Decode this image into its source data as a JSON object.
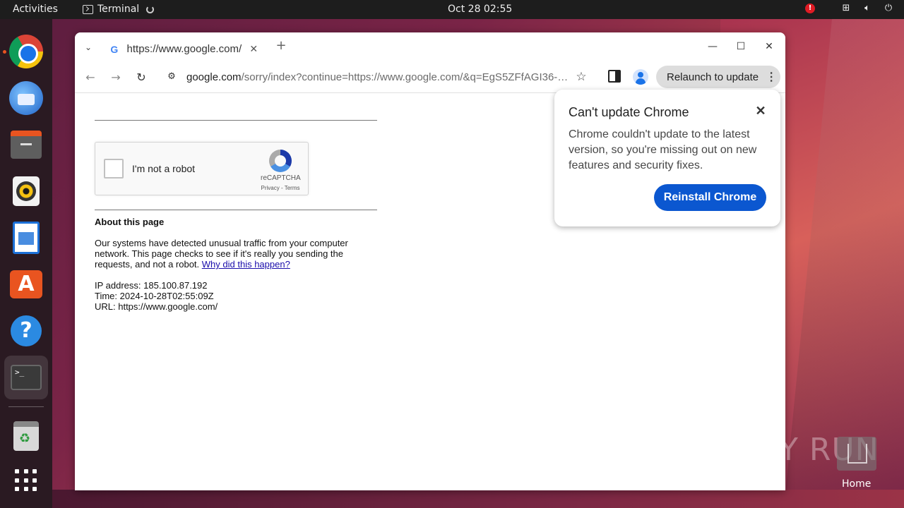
{
  "topbar": {
    "activities": "Activities",
    "app_name": "Terminal",
    "clock": "Oct 28  02:55",
    "alert": "!"
  },
  "dock": {
    "apps": [
      "chrome-icon",
      "thunderbird-icon",
      "files-icon",
      "rhythmbox-icon",
      "writer-icon",
      "app-center-icon",
      "help-icon",
      "terminal-icon",
      "trash-icon",
      "show-apps-icon"
    ],
    "terminal_glyph": ">_"
  },
  "browser": {
    "tab_title": "https://www.google.com/",
    "new_tab": "+",
    "url_host": "google.com",
    "url_path": "/sorry/index?continue=https://www.google.com/&q=EgS5ZFfAGI36-7gGI...",
    "relaunch_label": "Relaunch to update"
  },
  "page": {
    "captcha_label": "I'm not a robot",
    "captcha_brand": "reCAPTCHA",
    "captcha_links": "Privacy - Terms",
    "about_heading": "About this page",
    "about_text": "Our systems have detected unusual traffic from your computer network. This page checks to see if it's really you sending the requests, and not a robot. ",
    "why_link": "Why did this happen?",
    "ip_line": "IP address: 185.100.87.192",
    "time_line": "Time: 2024-10-28T02:55:09Z",
    "url_line": "URL: https://www.google.com/"
  },
  "popup": {
    "title": "Can't update Chrome",
    "body": "Chrome couldn't update to the latest version, so you're missing out on new features and security fixes.",
    "button": "Reinstall Chrome"
  },
  "desktop": {
    "watermark": "ANY RUN",
    "home_label": "Home"
  },
  "colors": {
    "accent_blue": "#0b57d0",
    "ubuntu_orange": "#e95420"
  }
}
